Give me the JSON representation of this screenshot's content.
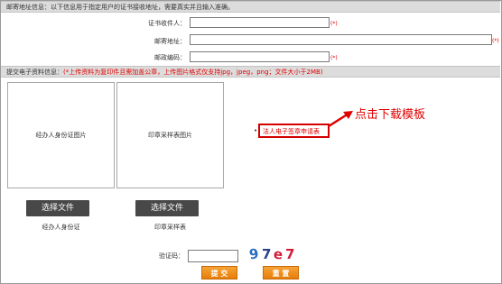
{
  "mailing": {
    "header": "邮寄地址信息：以下信息用于指定用户的证书接收地址，需要真实并且输入准确。",
    "recipient_label": "证书收件人：",
    "recipient_value": "",
    "address_label": "邮寄地址：",
    "address_value": "",
    "postcode_label": "邮政编码：",
    "postcode_value": "",
    "required_mark": "(*)"
  },
  "upload": {
    "header_label": "提交电子资料信息：",
    "header_note": "(*上传资料为复印件且需加盖公章，上传图片格式仅支持jpg，jpeg，png；文件大小于2MB)",
    "id_card_placeholder": "经办人身份证图片",
    "form_placeholder": "印章采样表图片",
    "choose_file_label": "选择文件",
    "id_card_caption": "经办人身份证",
    "form_caption": "印章采样表",
    "bullet": "•",
    "download_link": "法人电子签章申请表",
    "callout_text": "点击下载模板"
  },
  "captcha": {
    "label": "验证码：",
    "value": "",
    "image_text": "9 7 e 7"
  },
  "actions": {
    "submit_label": "提 交",
    "reset_label": "重 置"
  },
  "colors": {
    "accent_red": "#e00000",
    "button_orange": "#f19520",
    "file_button": "#484848"
  }
}
